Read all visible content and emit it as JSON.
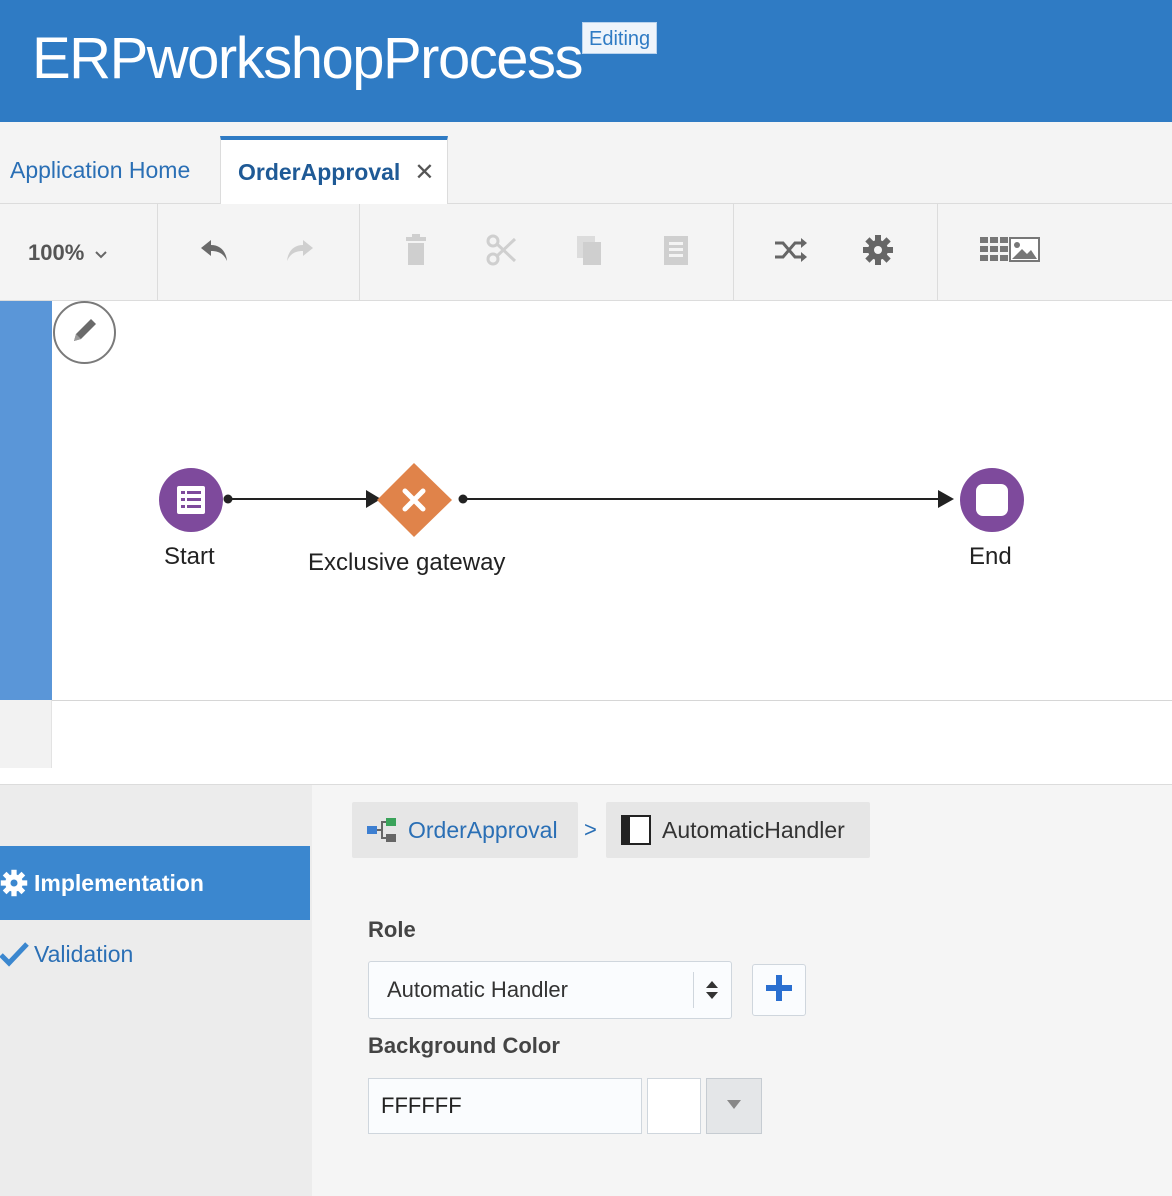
{
  "header": {
    "title": "ERPworkshopProcess",
    "status_badge": "Editing"
  },
  "tabs": [
    {
      "label": "Application Home",
      "active": false
    },
    {
      "label": "OrderApproval",
      "active": true,
      "closable": true
    }
  ],
  "toolbar": {
    "zoom": "100%",
    "buttons": [
      "undo-icon",
      "redo-icon",
      "delete-icon",
      "cut-icon",
      "copy-icon",
      "paste-icon",
      "shuffle-icon",
      "gear-icon",
      "grid-image-icon"
    ]
  },
  "diagram": {
    "nodes": [
      {
        "label": "Start",
        "type": "start-event",
        "color": "#7e4a9c"
      },
      {
        "label": "Exclusive gateway",
        "type": "exclusive-gateway",
        "color": "#e0834a"
      },
      {
        "label": "End",
        "type": "end-event",
        "color": "#7e4a9c"
      }
    ]
  },
  "nav": {
    "items": [
      {
        "label": "Implementation",
        "icon": "gear-icon",
        "active": true
      },
      {
        "label": "Validation",
        "icon": "check-icon",
        "active": false
      }
    ]
  },
  "breadcrumb": {
    "items": [
      {
        "label": "OrderApproval",
        "icon": "process-icon"
      },
      {
        "label": "AutomaticHandler",
        "icon": "swimlane-icon"
      }
    ],
    "separator": ">"
  },
  "properties": {
    "role_label": "Role",
    "role_value": "Automatic Handler",
    "bg_color_label": "Background Color",
    "bg_color_value": "FFFFFF"
  },
  "colors": {
    "header": "#2f7bc4",
    "accent": "#3b87cf",
    "event": "#7e4a9c",
    "gateway": "#e0834a",
    "swimlane": "#5a96d8"
  }
}
